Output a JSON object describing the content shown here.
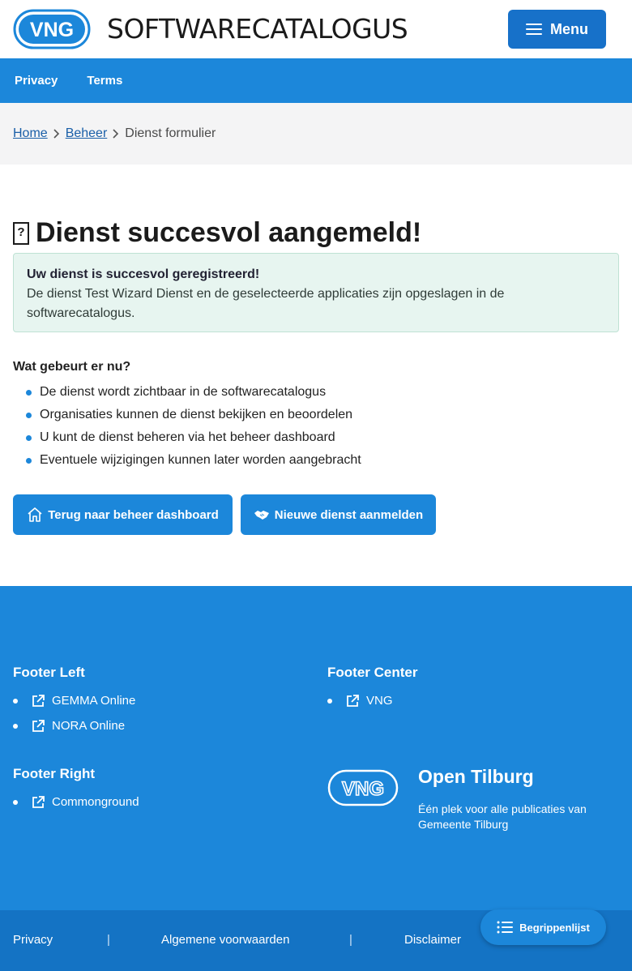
{
  "header": {
    "logo_text": "VNG",
    "brand": "SOFTWARECATALOGUS",
    "menu_label": "Menu"
  },
  "topnav": [
    {
      "label": "Privacy"
    },
    {
      "label": "Terms"
    }
  ],
  "breadcrumb": {
    "home": "Home",
    "beheer": "Beheer",
    "current": "Dienst formulier"
  },
  "main": {
    "title_icon": "?",
    "title": "Dienst succesvol aangemeld!",
    "alert": {
      "title": "Uw dienst is succesvol geregistreerd!",
      "body": "De dienst Test Wizard Dienst en de geselecteerde applicaties zijn opgeslagen in de softwarecatalogus."
    },
    "next_title": "Wat gebeurt er nu?",
    "steps": [
      "De dienst wordt zichtbaar in de softwarecatalogus",
      "Organisaties kunnen de dienst bekijken en beoordelen",
      "U kunt de dienst beheren via het beheer dashboard",
      "Eventuele wijzigingen kunnen later worden aangebracht"
    ],
    "buttons": {
      "back": "Terug naar beheer dashboard",
      "new": "Nieuwe dienst aanmelden"
    }
  },
  "footer": {
    "left": {
      "title": "Footer Left",
      "links": [
        "GEMMA Online",
        "NORA Online"
      ]
    },
    "center": {
      "title": "Footer Center",
      "links": [
        "VNG"
      ]
    },
    "right": {
      "title": "Footer Right",
      "links": [
        "Commonground"
      ]
    },
    "org": {
      "logo_text": "VNG",
      "title": "Open Tilburg",
      "subtitle": "Één plek voor alle publicaties van Gemeente Tilburg"
    }
  },
  "bottombar": {
    "items": [
      "Privacy",
      "Algemene voorwaarden",
      "Disclaimer"
    ],
    "separator": "|"
  },
  "begrippenlijst": "Begrippenlijst",
  "colors": {
    "primary": "#1c87da",
    "primary_dark": "#1473c4",
    "menu_button": "#1771c9",
    "alert_bg": "#e7f5f0"
  }
}
